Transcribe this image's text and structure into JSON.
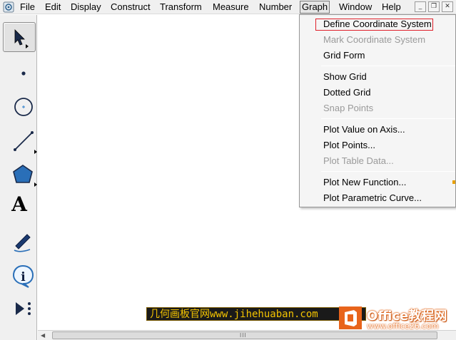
{
  "menubar": {
    "items": [
      {
        "label": "File"
      },
      {
        "label": "Edit"
      },
      {
        "label": "Display"
      },
      {
        "label": "Construct"
      },
      {
        "label": "Transform"
      },
      {
        "label": "Measure"
      },
      {
        "label": "Number"
      },
      {
        "label": "Graph",
        "active": true
      },
      {
        "label": "Window"
      },
      {
        "label": "Help"
      }
    ],
    "window_buttons": [
      "minimize-icon",
      "restore-icon",
      "close-icon"
    ]
  },
  "toolbox": {
    "tools": [
      {
        "name": "arrow-selection-tool",
        "icon": "arrow-icon",
        "selected": true
      },
      {
        "name": "point-tool",
        "icon": "point-icon"
      },
      {
        "name": "compass-tool",
        "icon": "circle-icon"
      },
      {
        "name": "straightedge-tool",
        "icon": "segment-icon"
      },
      {
        "name": "polygon-tool",
        "icon": "pentagon-icon"
      },
      {
        "name": "text-tool",
        "icon": "letter-a-icon",
        "glyph": "A"
      },
      {
        "name": "marker-tool",
        "icon": "pen-icon"
      },
      {
        "name": "information-tool",
        "icon": "info-icon"
      },
      {
        "name": "custom-tool",
        "icon": "play-custom-icon"
      }
    ]
  },
  "graph_menu": {
    "items": [
      {
        "label": "Define Coordinate System",
        "enabled": true,
        "highlighted": true
      },
      {
        "label": "Mark Coordinate System",
        "enabled": false
      },
      {
        "label": "Grid Form",
        "enabled": true
      },
      {
        "separator": true
      },
      {
        "label": "Show Grid",
        "enabled": true
      },
      {
        "label": "Dotted Grid",
        "enabled": true
      },
      {
        "label": "Snap Points",
        "enabled": false
      },
      {
        "separator": true
      },
      {
        "label": "Plot Value on Axis...",
        "enabled": true
      },
      {
        "label": "Plot Points...",
        "enabled": true
      },
      {
        "label": "Plot Table Data...",
        "enabled": false
      },
      {
        "separator": true
      },
      {
        "label": "Plot New Function...",
        "enabled": true,
        "submenu_marker": true
      },
      {
        "label": "Plot Parametric Curve...",
        "enabled": true
      }
    ]
  },
  "watermark": {
    "text": "几何画板官网www.jihehuaban.com"
  },
  "office_logo": {
    "title": "Office教程网",
    "url": "www.office26.com",
    "accent": "#e8641b"
  },
  "colors": {
    "menubar_bg": "#f0f0f0",
    "highlight_border": "#e0202a",
    "watermark_text": "#f4c400"
  }
}
